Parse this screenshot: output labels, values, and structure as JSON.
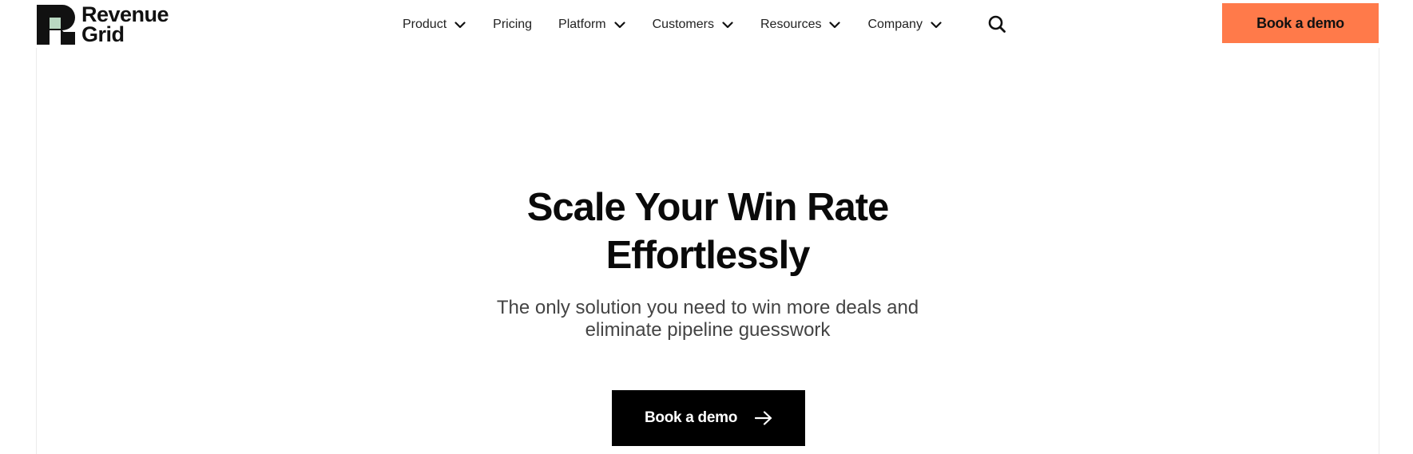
{
  "header": {
    "logo": {
      "line1": "Revenue",
      "line2": "Grid",
      "icon": "revenue-grid-logo-mark",
      "colors": {
        "mark": "#111111",
        "accent": "#b9d8c2"
      }
    },
    "nav": [
      {
        "label": "Product",
        "has_dropdown": true
      },
      {
        "label": "Pricing",
        "has_dropdown": false
      },
      {
        "label": "Platform",
        "has_dropdown": true
      },
      {
        "label": "Customers",
        "has_dropdown": true
      },
      {
        "label": "Resources",
        "has_dropdown": true
      },
      {
        "label": "Company",
        "has_dropdown": true
      }
    ],
    "search_icon": "search-icon",
    "cta_label": "Book a demo",
    "cta_color": "#ff7a4a"
  },
  "hero": {
    "title_line1": "Scale Your Win Rate",
    "title_line2": "Effortlessly",
    "subtitle_line1": "The only solution you need to win more deals and",
    "subtitle_line2": "eliminate pipeline guesswork",
    "cta_label": "Book a demo",
    "cta_icon": "arrow-right-icon",
    "cta_color": "#000000"
  }
}
